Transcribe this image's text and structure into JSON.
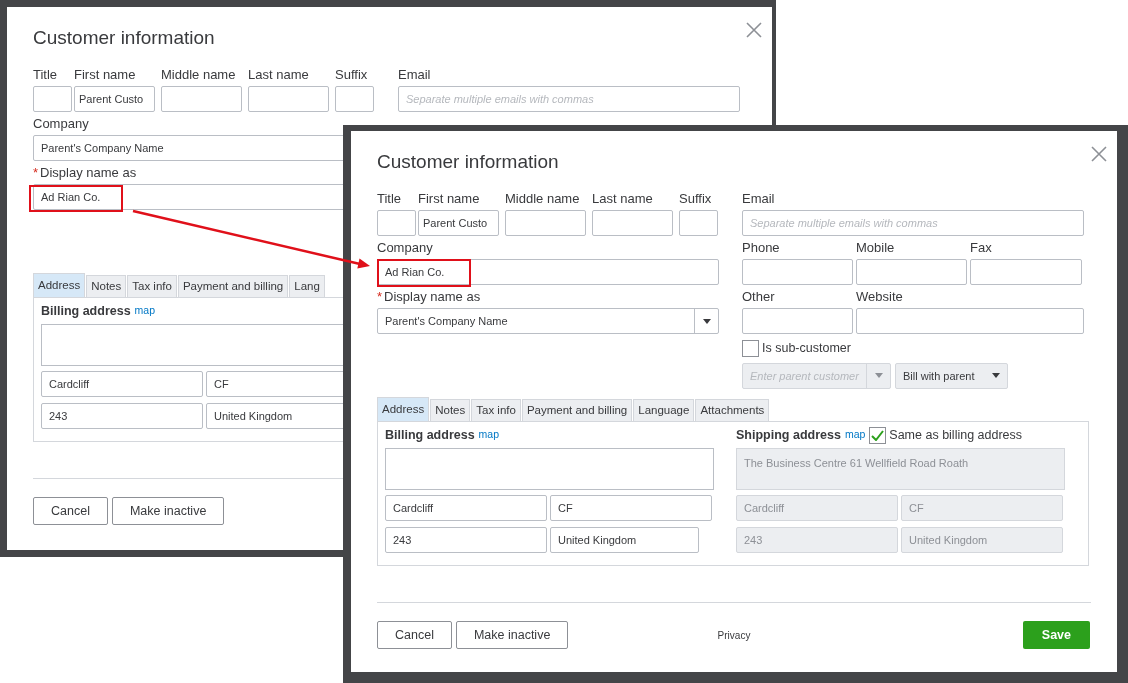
{
  "dialogs": [
    {
      "title": "Customer information",
      "name_fields": [
        {
          "label": "Title"
        },
        {
          "label": "First name",
          "value": "Parent Custo"
        },
        {
          "label": "Middle name"
        },
        {
          "label": "Last name"
        },
        {
          "label": "Suffix"
        }
      ],
      "company": {
        "label": "Company",
        "value": "Parent's Company Name"
      },
      "display_name": {
        "label": "Display name as",
        "value": "Ad Rian Co.",
        "marker": "*",
        "kind": "input"
      },
      "email": {
        "label": "Email",
        "placeholder": "Separate multiple emails with commas"
      },
      "tabs": [
        {
          "label": "Address",
          "selected": true
        },
        {
          "label": "Notes",
          "selected": false
        },
        {
          "label": "Tax info",
          "selected": false
        },
        {
          "label": "Payment and billing",
          "selected": false
        },
        {
          "label": "Lang",
          "selected": false
        }
      ],
      "billing": {
        "label": "Billing address",
        "link": "map",
        "lines": [
          "Cardcliff",
          "CF",
          "243",
          "United Kingdom"
        ]
      },
      "buttons": [
        {
          "label": "Cancel",
          "kind": "secondary"
        },
        {
          "label": "Make inactive",
          "kind": "secondary"
        }
      ]
    },
    {
      "title": "Customer information",
      "name_fields": [
        {
          "label": "Title"
        },
        {
          "label": "First name",
          "value": "Parent Custo"
        },
        {
          "label": "Middle name"
        },
        {
          "label": "Last name"
        },
        {
          "label": "Suffix"
        }
      ],
      "company": {
        "label": "Company",
        "value": "Ad Rian Co."
      },
      "display_name": {
        "label": "Display name as",
        "value": "Parent's Company Name",
        "marker": "*",
        "kind": "select"
      },
      "email": {
        "label": "Email",
        "placeholder": "Separate multiple emails with commas"
      },
      "contact_rows": [
        [
          {
            "label": "Phone"
          },
          {
            "label": "Mobile"
          },
          {
            "label": "Fax"
          }
        ],
        [
          {
            "label": "Other"
          },
          {
            "label": "Website"
          }
        ]
      ],
      "sub_customer": {
        "label": "Is sub-customer",
        "checked": false
      },
      "parent_customer": {
        "placeholder": "Enter parent customer",
        "disabled": true
      },
      "billing_option": {
        "value": "Bill with parent",
        "disabled": true
      },
      "tabs": [
        {
          "label": "Address",
          "selected": true
        },
        {
          "label": "Notes",
          "selected": false
        },
        {
          "label": "Tax info",
          "selected": false
        },
        {
          "label": "Payment and billing",
          "selected": false
        },
        {
          "label": "Language",
          "selected": false
        },
        {
          "label": "Attachments",
          "selected": false
        }
      ],
      "billing": {
        "label": "Billing address",
        "link": "map",
        "lines": [
          "Cardcliff",
          "CF",
          "243",
          "United Kingdom"
        ]
      },
      "shipping": {
        "label": "Shipping address",
        "link": "map",
        "same_as_billing": {
          "label": "Same as billing address",
          "checked": true
        },
        "street": "The Business Centre 61 Wellfield Road Roath",
        "lines": [
          "Cardcliff",
          "CF",
          "243",
          "United Kingdom"
        ],
        "disabled": true
      },
      "privacy": "Privacy",
      "buttons": [
        {
          "label": "Cancel",
          "kind": "secondary"
        },
        {
          "label": "Make inactive",
          "kind": "secondary"
        },
        {
          "label": "Save",
          "kind": "primary"
        }
      ]
    }
  ]
}
